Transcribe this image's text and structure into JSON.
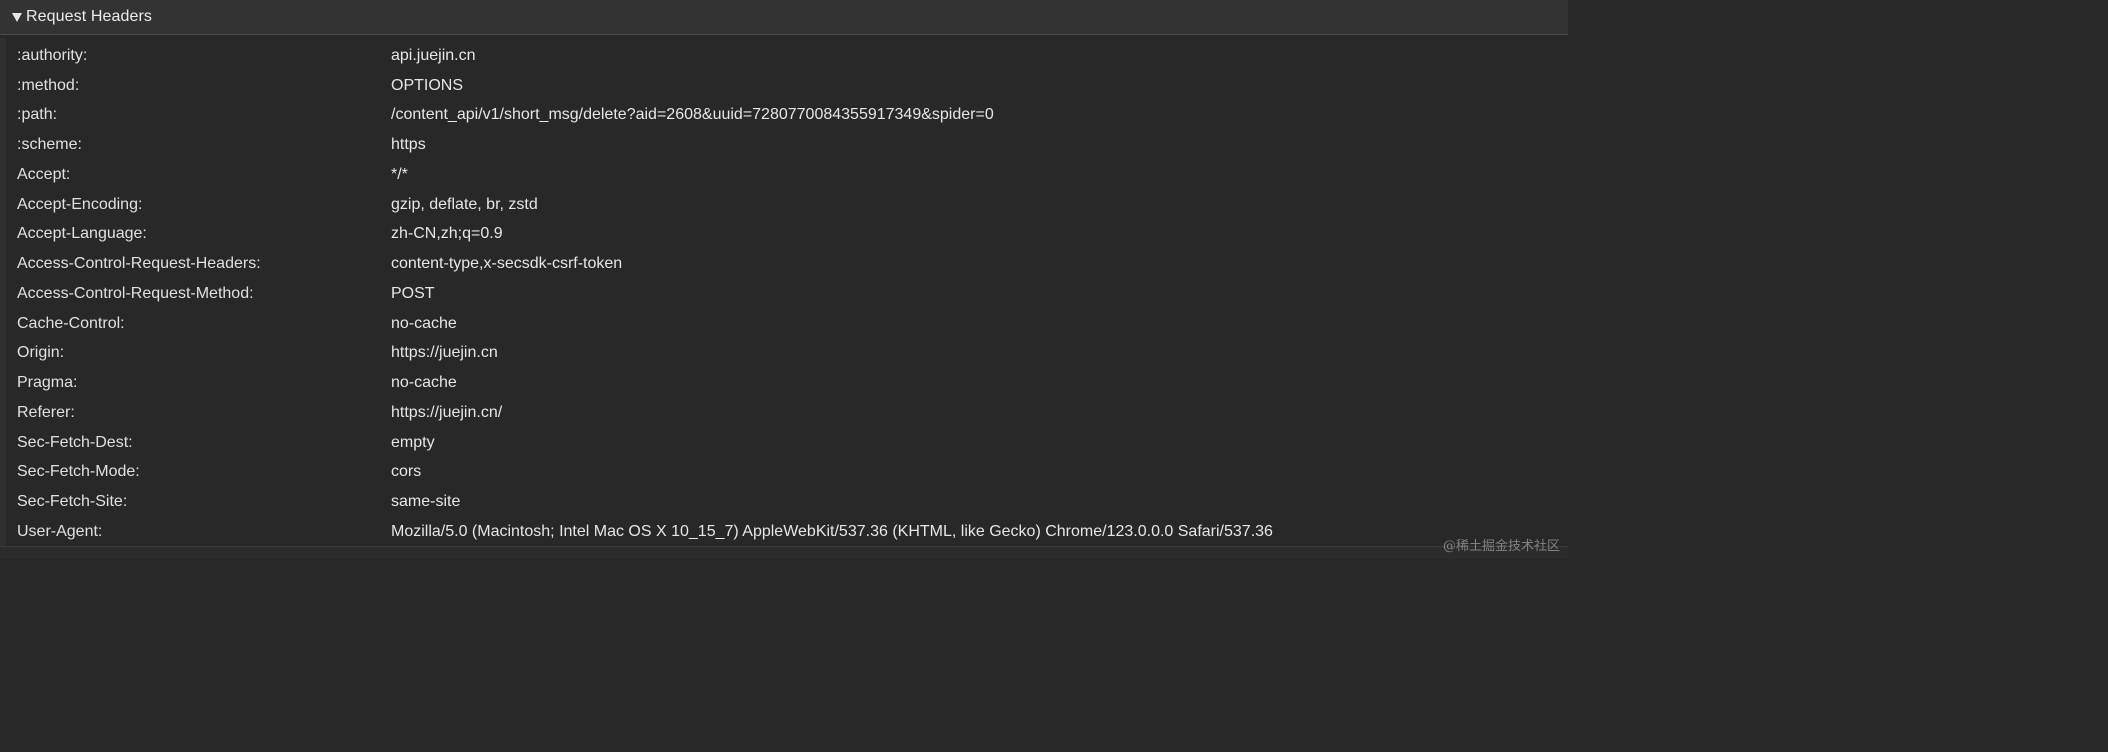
{
  "section": {
    "title": "Request Headers",
    "expanded": true
  },
  "headers": [
    {
      "name": ":authority:",
      "value": "api.juejin.cn"
    },
    {
      "name": ":method:",
      "value": "OPTIONS"
    },
    {
      "name": ":path:",
      "value": "/content_api/v1/short_msg/delete?aid=2608&uuid=7280770084355917349&spider=0"
    },
    {
      "name": ":scheme:",
      "value": "https"
    },
    {
      "name": "Accept:",
      "value": "*/*"
    },
    {
      "name": "Accept-Encoding:",
      "value": "gzip, deflate, br, zstd"
    },
    {
      "name": "Accept-Language:",
      "value": "zh-CN,zh;q=0.9"
    },
    {
      "name": "Access-Control-Request-Headers:",
      "value": "content-type,x-secsdk-csrf-token"
    },
    {
      "name": "Access-Control-Request-Method:",
      "value": "POST"
    },
    {
      "name": "Cache-Control:",
      "value": "no-cache"
    },
    {
      "name": "Origin:",
      "value": "https://juejin.cn"
    },
    {
      "name": "Pragma:",
      "value": "no-cache"
    },
    {
      "name": "Referer:",
      "value": "https://juejin.cn/"
    },
    {
      "name": "Sec-Fetch-Dest:",
      "value": "empty"
    },
    {
      "name": "Sec-Fetch-Mode:",
      "value": "cors"
    },
    {
      "name": "Sec-Fetch-Site:",
      "value": "same-site"
    },
    {
      "name": "User-Agent:",
      "value": "Mozilla/5.0 (Macintosh; Intel Mac OS X 10_15_7) AppleWebKit/537.36 (KHTML, like Gecko) Chrome/123.0.0.0 Safari/537.36"
    }
  ],
  "watermark": "@稀土掘金技术社区",
  "colors": {
    "background": "#282828",
    "header_bar": "#333333",
    "text": "#e6e6e6"
  }
}
